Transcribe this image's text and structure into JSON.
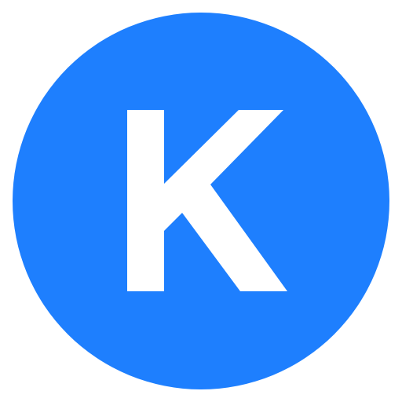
{
  "avatar": {
    "letter": "K",
    "background_color": "#1e7ffe",
    "letter_color": "#ffffff",
    "icon": "letter-avatar-icon"
  }
}
